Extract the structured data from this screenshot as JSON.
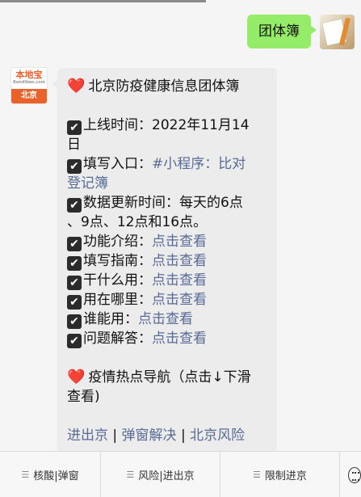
{
  "outgoing": {
    "text": "团体簿"
  },
  "bot": {
    "avatar_brand": "本地宝",
    "avatar_sub": "Bendibao.com",
    "avatar_city": "北京"
  },
  "message": {
    "title": "北京防疫健康信息团体簿",
    "online_label": "上线时间：2022年11月14",
    "online_label_cont": "日",
    "entry_label": "填写入口：",
    "entry_link": "#小程序：比对",
    "entry_link_cont": "登记簿",
    "update_label": "数据更新时间：每天的6点",
    "update_label_cont": "、9点、12点和16点。",
    "items": [
      {
        "label": "功能介绍：",
        "link": "点击查看"
      },
      {
        "label": "填写指南：",
        "link": "点击查看"
      },
      {
        "label": "干什么用：",
        "link": "点击查看"
      },
      {
        "label": "用在哪里：",
        "link": "点击查看"
      },
      {
        "label": "谁能用：",
        "link": "点击查看"
      },
      {
        "label": "问题解答：",
        "link": "点击查看"
      }
    ],
    "nav_title": "疫情热点导航（点击↓下滑",
    "nav_title_cont": "查看)",
    "nav_links": [
      "进出京",
      "弹窗解决",
      "北京风险"
    ]
  },
  "menu": [
    {
      "label": "核酸|弹窗"
    },
    {
      "label": "风险|进出京"
    },
    {
      "label": "限制进京"
    }
  ],
  "menu_icon": "keyboard-icon",
  "check_glyph": "✔",
  "heart_glyph": "❤️"
}
